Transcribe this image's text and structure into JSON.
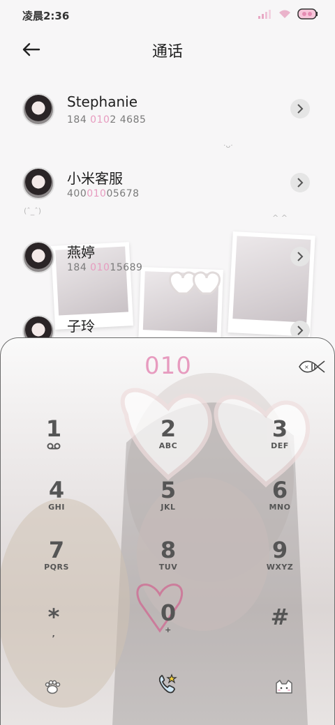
{
  "status_bar": {
    "time": "凌晨2:36"
  },
  "header": {
    "title": "通话",
    "back_icon": "back-arrow-icon"
  },
  "contacts": [
    {
      "name": "Stephanie",
      "number_pre": "184 ",
      "number_hl": "010",
      "number_post": "2 4685"
    },
    {
      "name": "小米客服",
      "number_pre": "400",
      "number_hl": "010",
      "number_post": "05678"
    },
    {
      "name": "燕婷",
      "number_pre": "184 ",
      "number_hl": "010",
      "number_post": "15689"
    },
    {
      "name": "子玲",
      "number_pre": "",
      "number_hl": "",
      "number_post": ""
    }
  ],
  "dialpad": {
    "number": "010",
    "keys": [
      {
        "digit": "1",
        "letters": ""
      },
      {
        "digit": "2",
        "letters": "ABC"
      },
      {
        "digit": "3",
        "letters": "DEF"
      },
      {
        "digit": "4",
        "letters": "GHI"
      },
      {
        "digit": "5",
        "letters": "JKL"
      },
      {
        "digit": "6",
        "letters": "MNO"
      },
      {
        "digit": "7",
        "letters": "PQRS"
      },
      {
        "digit": "8",
        "letters": "TUV"
      },
      {
        "digit": "9",
        "letters": "WXYZ"
      },
      {
        "digit": "*",
        "letters": ","
      },
      {
        "digit": "0",
        "letters": "+"
      },
      {
        "digit": "#",
        "letters": ""
      }
    ]
  },
  "colors": {
    "accent": "#e79bbf",
    "key_text": "#555555"
  }
}
